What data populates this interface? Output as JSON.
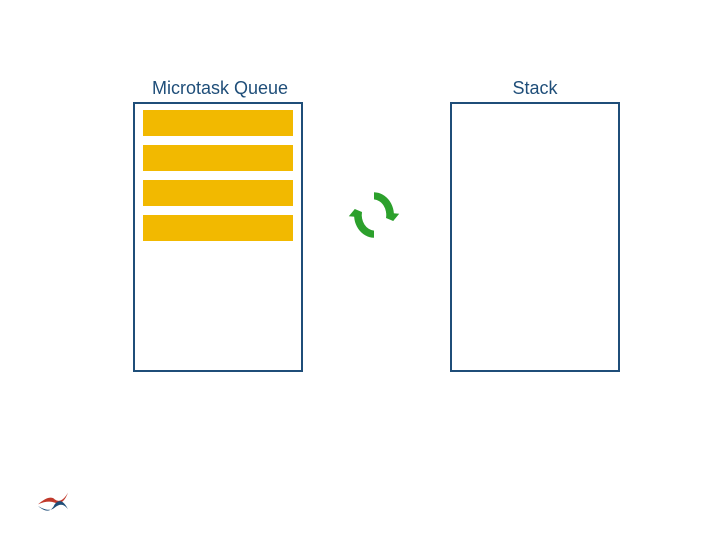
{
  "labels": {
    "microtask_queue": "Microtask Queue",
    "stack": "Stack"
  },
  "queue": {
    "task_count": 4
  },
  "colors": {
    "border": "#1f4e79",
    "task": "#f2b900",
    "cycle": "#2ca02c",
    "logo_red": "#c0392b",
    "logo_blue": "#1f4e79"
  }
}
